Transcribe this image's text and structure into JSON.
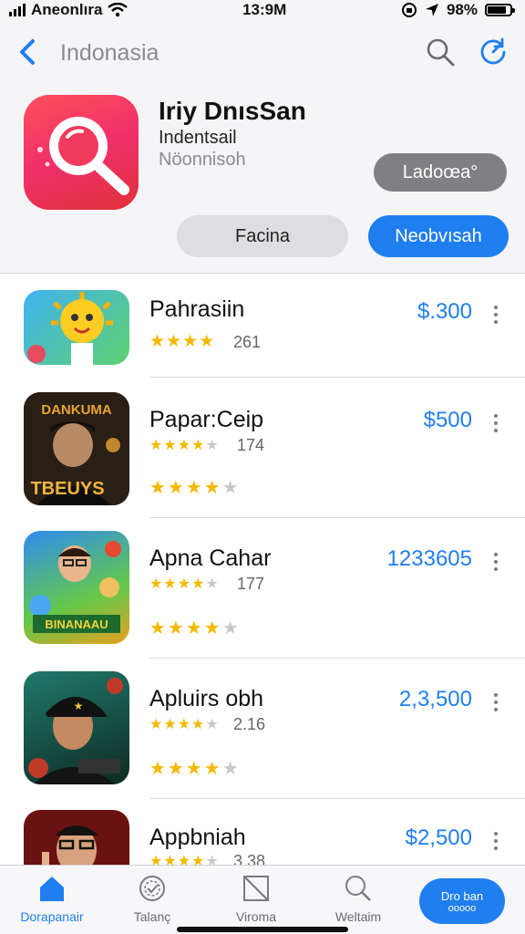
{
  "status": {
    "carrier": "Aneonlıra",
    "time": "13:9M",
    "battery": "98%"
  },
  "nav": {
    "title": "Indonasia"
  },
  "app": {
    "name": "Iriy DnısSan",
    "subtitle": "Indentsail",
    "category": "Nöonnisoh",
    "get_label": "Ladoœa°",
    "secondary_label": "Facina",
    "primary_label": "Neobvısah"
  },
  "list": [
    {
      "name": "Pahrasiin",
      "rating_count": "261",
      "price": "$.300",
      "stars": 4
    },
    {
      "name": "Papar:Ceip",
      "rating_count": "174",
      "price": "$500",
      "stars": 4,
      "icon_text_top": "DANKUMA",
      "icon_text_bottom": "TBEUYS"
    },
    {
      "name": "Apna Cahar",
      "rating_count": "177",
      "price": "1233605",
      "stars": 4,
      "icon_text": "BINANAAU"
    },
    {
      "name": "Apluirs obh",
      "rating_count": "2.16",
      "price": "2,3,500",
      "stars": 4
    },
    {
      "name": "Appbniah",
      "rating_count": "3.38",
      "price": "$2,500",
      "stars": 4
    }
  ],
  "tabs": [
    {
      "label": "Dorapanair",
      "icon": "home-icon"
    },
    {
      "label": "Talanç",
      "icon": "badge-icon"
    },
    {
      "label": "Viroma",
      "icon": "frame-icon"
    },
    {
      "label": "Weltaim",
      "icon": "search-icon"
    },
    {
      "label": "Dro ban",
      "sublabel": "ooooo",
      "icon": "special-icon"
    }
  ],
  "colors": {
    "accent": "#1f7ef0",
    "star": "#f5b800",
    "icon_red": "#f0306a"
  }
}
